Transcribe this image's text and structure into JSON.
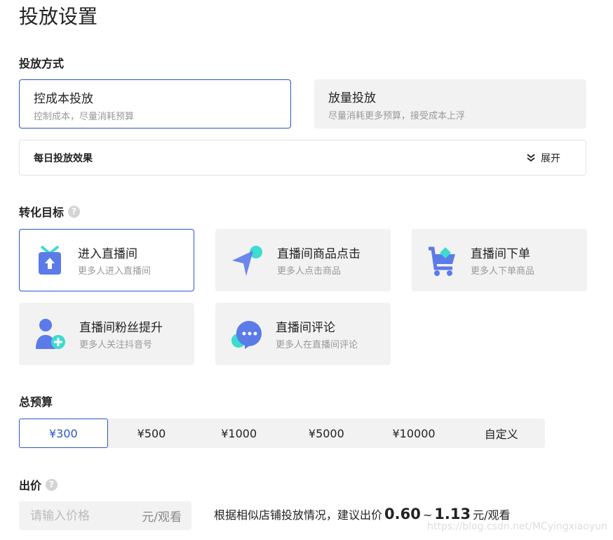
{
  "title": "投放设置",
  "mode": {
    "label": "投放方式",
    "options": [
      {
        "title": "控成本投放",
        "desc": "控制成本，尽量消耗预算",
        "selected": true
      },
      {
        "title": "放量投放",
        "desc": "尽量消耗更多预算，接受成本上浮",
        "selected": false
      }
    ]
  },
  "daily": {
    "label": "每日投放效果",
    "expand": "展开"
  },
  "target": {
    "label": "转化目标",
    "help": "?",
    "options": [
      {
        "title": "进入直播间",
        "desc": "更多人进入直播间",
        "icon": "tv-icon",
        "selected": true
      },
      {
        "title": "直播间商品点击",
        "desc": "更多人点击商品",
        "icon": "cursor-icon"
      },
      {
        "title": "直播间下单",
        "desc": "更多人下单商品",
        "icon": "cart-icon"
      },
      {
        "title": "直播间粉丝提升",
        "desc": "更多人关注抖音号",
        "icon": "add-user-icon"
      },
      {
        "title": "直播间评论",
        "desc": "更多人在直播间评论",
        "icon": "comment-icon"
      }
    ]
  },
  "budget": {
    "label": "总预算",
    "options": [
      "¥300",
      "¥500",
      "¥1000",
      "¥5000",
      "¥10000",
      "自定义"
    ],
    "selected": "¥300"
  },
  "bid": {
    "label": "出价",
    "help": "?",
    "placeholder": "请输入价格",
    "unit": "元/观看",
    "suggest_prefix": "根据相似店铺投放情况，建议出价",
    "min": "0.60",
    "sep": "~",
    "max": "1.13",
    "suggest_unit": "元/观看"
  },
  "watermark": "https://blog.csdn.net/MCyingxiaoyun",
  "colors": {
    "accent": "#2b56c6",
    "icon_blue": "#5b7be8",
    "icon_teal": "#3ddbd0"
  }
}
